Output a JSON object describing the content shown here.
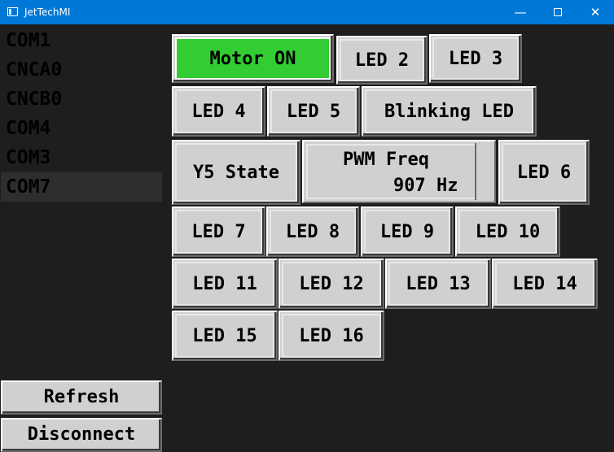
{
  "window": {
    "title": "JetTechMI",
    "minimize_glyph": "—",
    "close_glyph": "✕"
  },
  "ports": [
    "COM1",
    "CNCA0",
    "CNCB0",
    "COM4",
    "COM3",
    "COM7"
  ],
  "selected_port": "COM7",
  "sidebar": {
    "refresh_label": "Refresh",
    "disconnect_label": "Disconnect"
  },
  "buttons": {
    "motor": "Motor ON",
    "led2": "LED 2",
    "led3": "LED 3",
    "led4": "LED 4",
    "led5": "LED 5",
    "blinking": "Blinking LED",
    "y5": "Y5 State",
    "led6": "LED 6",
    "led7": "LED 7",
    "led8": "LED 8",
    "led9": "LED 9",
    "led10": "LED 10",
    "led11": "LED 11",
    "led12": "LED 12",
    "led13": "LED 13",
    "led14": "LED 14",
    "led15": "LED 15",
    "led16": "LED 16"
  },
  "pwm": {
    "label": "PWM Freq",
    "value": "907 Hz"
  },
  "colors": {
    "titlebar": "#0078d7",
    "motor_on": "#33cc33",
    "button_face": "#d0d0d0",
    "background": "#1e1e1e"
  }
}
